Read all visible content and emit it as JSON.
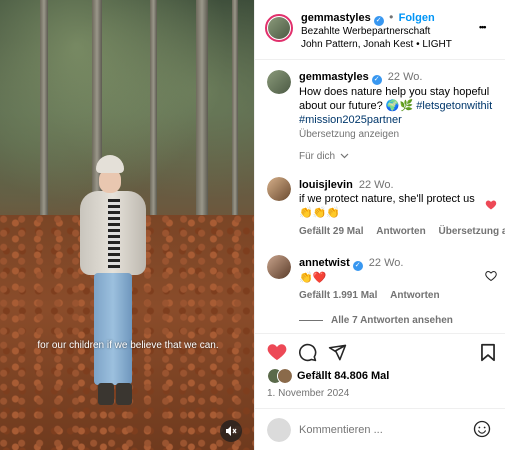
{
  "video": {
    "caption": "for our children if we believe that we can.",
    "mute_icon": "speaker-muted-icon"
  },
  "header": {
    "username": "gemmastyles",
    "separator": "•",
    "follow_label": "Folgen",
    "subtitle": "Bezahlte Werbepartnerschaft",
    "audio": "John Pattern, Jonah Kest • LIGHT",
    "more_label": "•••"
  },
  "post": {
    "username": "gemmastyles",
    "time": "22 Wo.",
    "text": "How does nature help you stay hopeful about our future? 🌍🌿",
    "hashtag1": "#letsgetonwithit",
    "hashtag2": "#mission2025partner",
    "translate": "Übersetzung anzeigen",
    "for_you": "Für dich"
  },
  "comments": [
    {
      "username": "louisjlevin",
      "time": "22 Wo.",
      "text": "if we protect nature, she'll protect us",
      "emoji": "👏👏👏",
      "likes": "Gefällt 29 Mal",
      "reply": "Antworten",
      "translate": "Übersetzung anze",
      "liked": true
    },
    {
      "username": "annetwist",
      "time": "22 Wo.",
      "emoji": "👏❤️",
      "likes": "Gefällt 1.991 Mal",
      "reply": "Antworten",
      "view_replies": "Alle 7 Antworten ansehen",
      "liked": false
    }
  ],
  "actions": {
    "likes": "Gefällt 84.806 Mal",
    "date": "1. November 2024"
  },
  "composer": {
    "placeholder": "Kommentieren ..."
  },
  "colors": {
    "like_red": "#ed4956",
    "link_blue": "#0095f6",
    "verified_blue": "#3897f0"
  }
}
